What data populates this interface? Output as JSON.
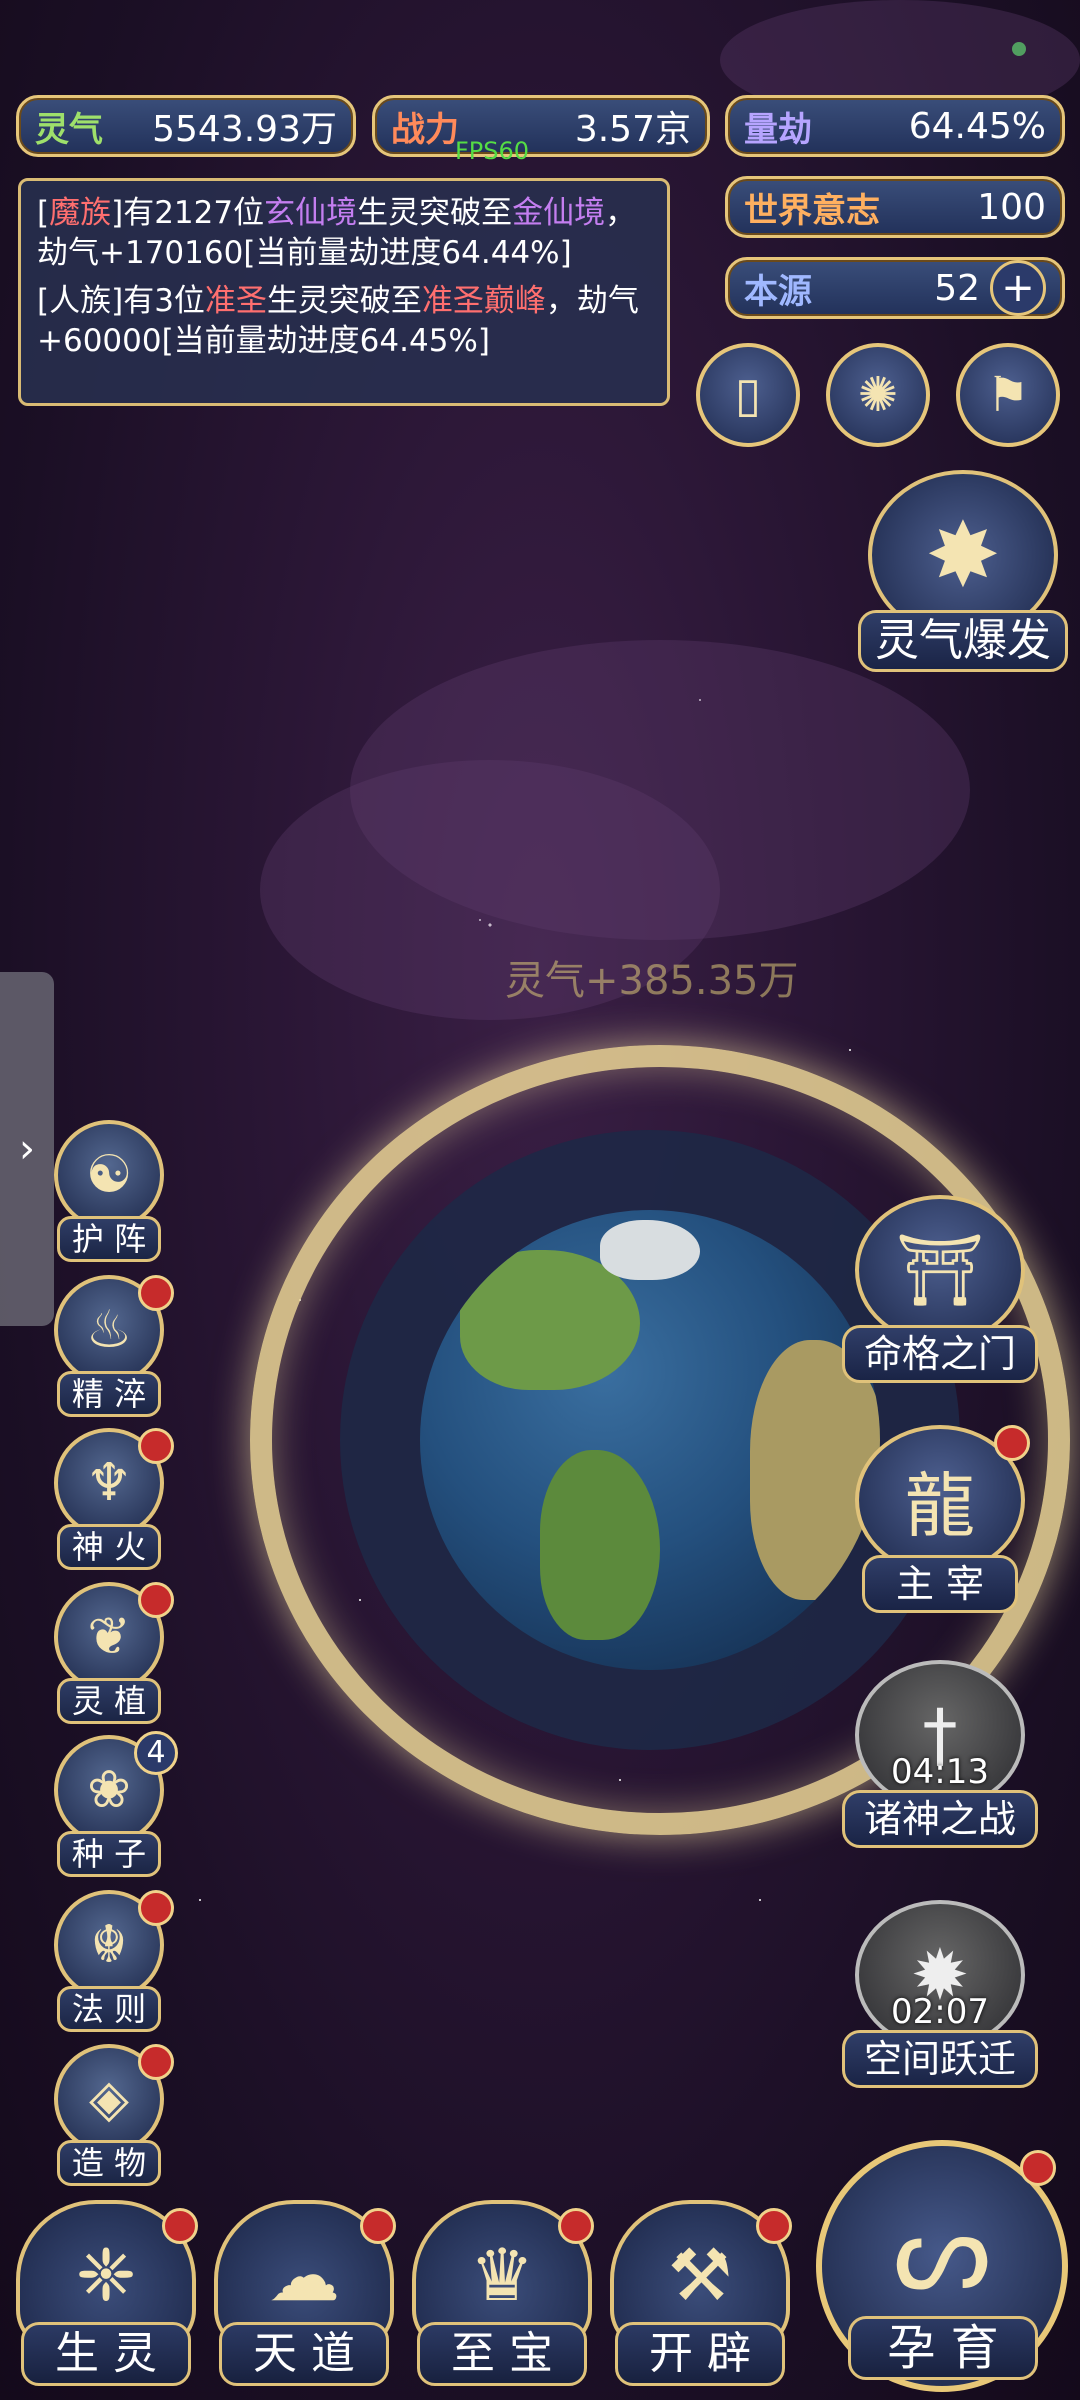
{
  "stats": {
    "lingqi": {
      "label": "灵气",
      "value": "5543.93万"
    },
    "zhanli": {
      "label": "战力",
      "value": "3.57京"
    },
    "liangjie": {
      "label": "量劫",
      "value": "64.45%"
    },
    "shijie": {
      "label": "世界意志",
      "value": "100"
    },
    "benyuan": {
      "label": "本源",
      "value": "52"
    }
  },
  "fps": "FPS60",
  "log": {
    "l1": {
      "a": "[",
      "b": "魔族",
      "c": "]有2127位",
      "d": "玄仙境",
      "e": "生灵突破至",
      "f": "金仙境",
      "g": "，劫气+170160[当前量劫进度64.44%]"
    },
    "l2": {
      "a": "[人族]有3位",
      "b": "准圣",
      "c": "生灵突破至",
      "d": "准圣巅峰",
      "e": "，劫气+60000[当前量劫进度64.45%]"
    }
  },
  "float_text": "灵气+385.35万",
  "burst_label": "灵气爆发",
  "left_buttons": {
    "huzhen": "护 阵",
    "jingcui": "精 淬",
    "shenhuo": "神 火",
    "lingzhi": "灵 植",
    "zhongzi": "种 子",
    "zhongzi_badge": "4",
    "faze": "法 则",
    "zaowu": "造 物"
  },
  "right_buttons": {
    "mingge": "命格之门",
    "zhuzai": "主 宰",
    "zhushen": "诸神之战",
    "zhushen_timer": "04:13",
    "kongjian": "空间跃迁",
    "kongjian_timer": "02:07"
  },
  "bottom": {
    "shengling": "生 灵",
    "tiandao": "天 道",
    "zhibao": "至 宝",
    "kaipi": "开 辟",
    "yunyu": "孕 育"
  },
  "colors": {
    "gold": "#e6c67a",
    "panel": "#22315a",
    "red_dot": "#c62b2b",
    "bg": "#2a1635"
  }
}
